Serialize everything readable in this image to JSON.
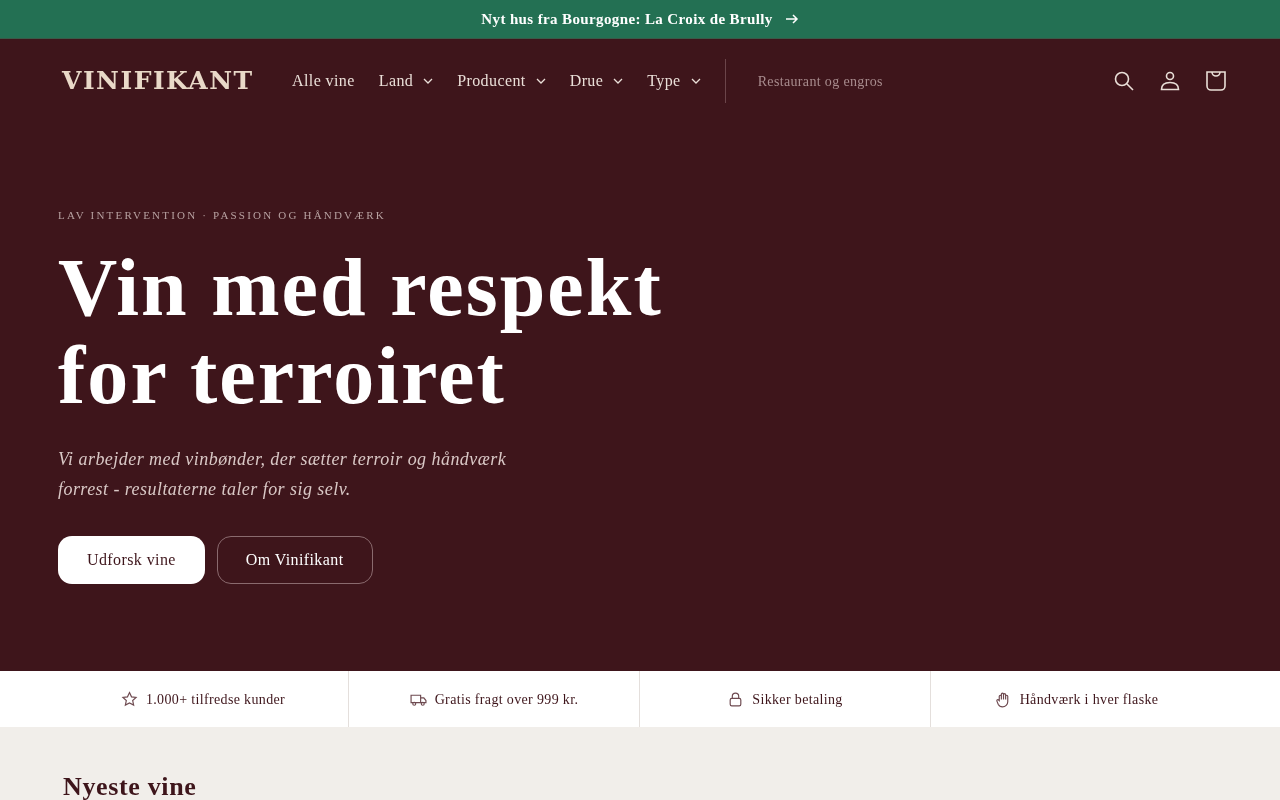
{
  "announcement": {
    "text": "Nyt hus fra Bourgogne: La Croix de Brully"
  },
  "header": {
    "logo": "VINIFIKANT",
    "nav": [
      {
        "label": "Alle vine",
        "dropdown": false
      },
      {
        "label": "Land",
        "dropdown": true
      },
      {
        "label": "Producent",
        "dropdown": true
      },
      {
        "label": "Drue",
        "dropdown": true
      },
      {
        "label": "Type",
        "dropdown": true
      }
    ],
    "secondary_link": "Restaurant og engros"
  },
  "hero": {
    "eyebrow": "LAV INTERVENTION · PASSION OG HÅNDVÆRK",
    "title_lines": [
      "Vin med respekt",
      "for terroiret"
    ],
    "text": "Vi arbejder med vinbønder, der sætter terroir og håndværk forrest - resultaterne taler for sig selv.",
    "buttons": [
      {
        "label": "Udforsk vine",
        "kind": "primary"
      },
      {
        "label": "Om Vinifikant",
        "kind": "secondary"
      }
    ]
  },
  "trust_bar": [
    {
      "text": "1.000+ tilfredse kunder"
    },
    {
      "text": "Gratis fragt over 999 kr."
    },
    {
      "text": "Sikker betaling"
    },
    {
      "text": "Håndværk i hver flaske"
    }
  ],
  "section_title": "Nyeste vine"
}
